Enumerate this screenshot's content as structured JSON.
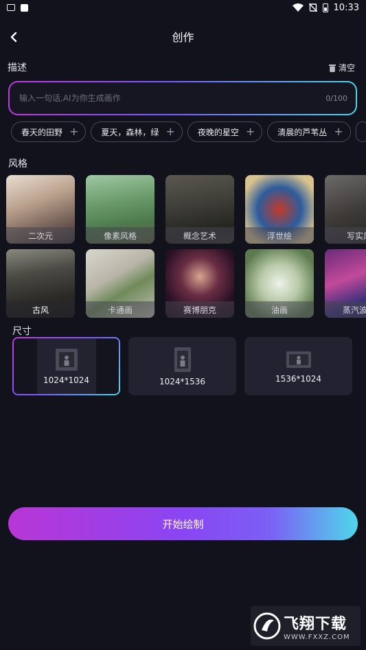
{
  "status_bar": {
    "time": "10:33"
  },
  "header": {
    "title": "创作"
  },
  "description": {
    "label": "描述",
    "clear_label": "清空",
    "placeholder": "输入一句话,AI为你生成画作",
    "counter": "0/100"
  },
  "suggestions": [
    {
      "label": "春天的田野"
    },
    {
      "label": "夏天，森林，绿"
    },
    {
      "label": "夜晚的星空"
    },
    {
      "label": "清晨的芦苇丛"
    },
    {
      "label": ""
    }
  ],
  "style": {
    "label": "风格",
    "items": [
      {
        "label": "二次元",
        "selected": false
      },
      {
        "label": "像素风格",
        "selected": false
      },
      {
        "label": "概念艺术",
        "selected": false
      },
      {
        "label": "浮世绘",
        "selected": false
      },
      {
        "label": "写实风",
        "selected": false
      },
      {
        "label": "古风",
        "selected": true
      },
      {
        "label": "卡通画",
        "selected": false
      },
      {
        "label": "赛博朋克",
        "selected": false
      },
      {
        "label": "油画",
        "selected": false
      },
      {
        "label": "蒸汽波艺",
        "selected": false
      }
    ]
  },
  "size": {
    "label": "尺寸",
    "options": [
      {
        "label": "1024*1024",
        "selected": true
      },
      {
        "label": "1024*1536",
        "selected": false
      },
      {
        "label": "1536*1024",
        "selected": false
      }
    ]
  },
  "start_button": {
    "label": "开始绘制"
  },
  "watermark": {
    "title": "飞翔下载",
    "sub": "WWW.FXXZ.COM"
  },
  "colors": {
    "accent_start": "#c13be0",
    "accent_mid": "#7b5cff",
    "accent_end": "#4fd7ea",
    "background": "#12121d"
  }
}
